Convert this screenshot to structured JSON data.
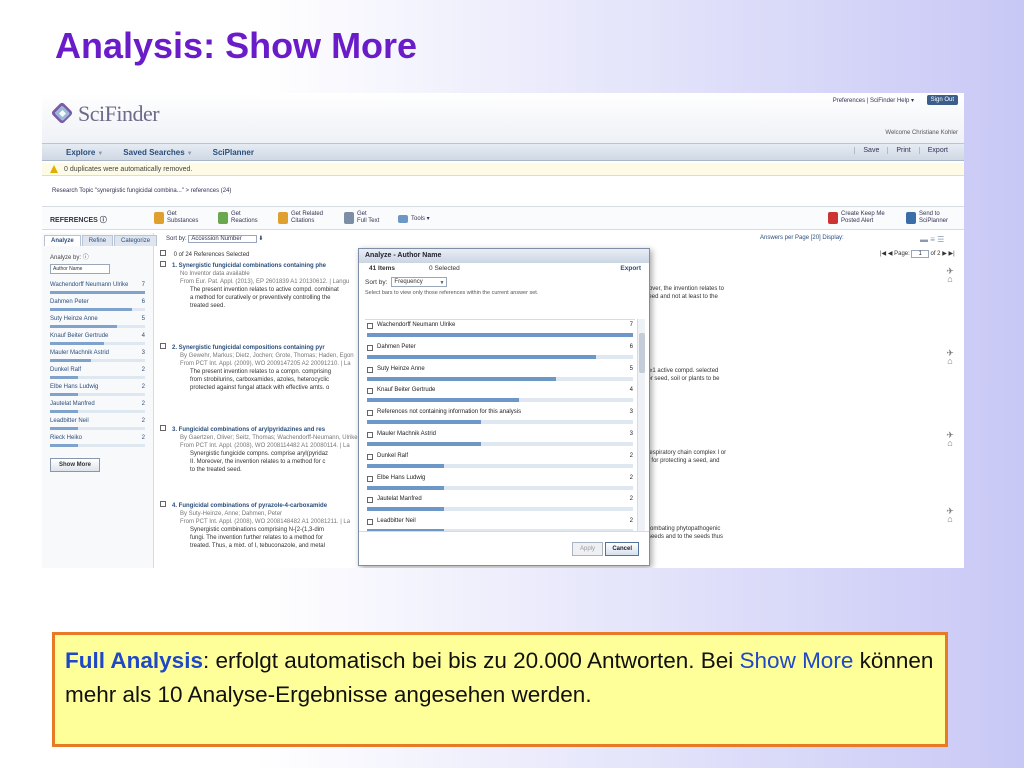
{
  "slide": {
    "title": "Analysis: Show More",
    "note": {
      "part1": "Full Analysis",
      "part2": ": erfolgt automatisch bei bis zu 20.000 Antworten. Bei ",
      "part3": "Show More",
      "part4": " können mehr als 10 Analyse-Ergebnisse angesehen werden."
    }
  },
  "app": {
    "logo": "SciFinder",
    "toplinks": "Preferences | SciFinder Help ▾",
    "signout": "Sign Out",
    "welcome": "Welcome Christiane Kohler",
    "nav": [
      "Explore",
      "Saved Searches",
      "SciPlanner"
    ],
    "nav_right": [
      "Save",
      "Print",
      "Export"
    ],
    "warning": "0 duplicates were automatically removed.",
    "breadcrumb": "Research Topic \"synergistic fungicidal combina...\" > references (24)",
    "references_label": "REFERENCES",
    "tools": [
      {
        "line1": "Get",
        "line2": "Substances",
        "color": "#e0a030"
      },
      {
        "line1": "Get",
        "line2": "Reactions",
        "color": "#6aa84f"
      },
      {
        "line1": "Get Related",
        "line2": "Citations",
        "color": "#e0a030"
      },
      {
        "line1": "Get",
        "line2": "Full Text",
        "color": "#7c8da6"
      },
      {
        "line1": "Tools ▾",
        "line2": "",
        "color": "#6d97c7"
      },
      {
        "line1": "Create Keep Me",
        "line2": "Posted Alert",
        "color": "#cc3333"
      },
      {
        "line1": "Send to",
        "line2": "SciPlanner",
        "color": "#3b6ea8"
      }
    ],
    "left": {
      "tabs": [
        "Analyze",
        "Refine",
        "Categorize"
      ],
      "analyze_by": "Analyze by:",
      "select": "Author Name",
      "authors": [
        {
          "name": "Wachendorff Neumann Ulrike",
          "count": "7",
          "pct": 100
        },
        {
          "name": "Dahmen Peter",
          "count": "6",
          "pct": 86
        },
        {
          "name": "Suty Heinze Anne",
          "count": "5",
          "pct": 71
        },
        {
          "name": "Knauf Beiter Gertrude",
          "count": "4",
          "pct": 57
        },
        {
          "name": "Mauler Machnik Astrid",
          "count": "3",
          "pct": 43
        },
        {
          "name": "Dunkel Ralf",
          "count": "2",
          "pct": 29
        },
        {
          "name": "Elbe Hans Ludwig",
          "count": "2",
          "pct": 29
        },
        {
          "name": "Jautelat Manfred",
          "count": "2",
          "pct": 29
        },
        {
          "name": "Leadbitter Neil",
          "count": "2",
          "pct": 29
        },
        {
          "name": "Rieck Heiko",
          "count": "2",
          "pct": 29
        }
      ],
      "show_more": "Show More"
    },
    "results": {
      "sort_label": "Sort by:",
      "sort_value": "Accession Number",
      "selected": "0 of 24 References Selected",
      "answers": "Answers per Page [20]  Display:",
      "page_label": "Page:",
      "page_value": "1",
      "page_of": "of 2",
      "items": [
        {
          "title": "1. Synergistic fungicidal combinations containing phe",
          "src1": "No Inventor data available",
          "src2": "From Eur. Pat. Appl. (2013), EP 2601839 A1 20130612. | Langu",
          "abs": "The present invention relates to active compd. combinat",
          "abs2": "a method for curatively or preventively controlling the",
          "abs3": "treated seed.",
          "right1": "deriv. and (B) Zoxamide and optionally (C) Cymoxanil.  Moreover, the invention relates to",
          "right2": "and for the treatment of seed, to a method for protecting a seed and not at least to the"
        },
        {
          "title": "2. Synergistic fungicidal compositions containing pyr",
          "src1": "By Gewehr, Markus; Dietz, Jochen; Grote, Thomas; Haden, Egon",
          "src2": "From PCT Int. Appl. (2009), WO 2009147205 A2 20091210. | La",
          "abs": "The present invention relates to a compn. comprising",
          "abs2": "from strobilurins, carboxamides, azoles, heterocyclic",
          "abs3": "protected against fungal attack with effective amts. o",
          "right1": "yl, or alkynyl; R³ = (un)substituted aryl: and X = O or S) and ≥1 active compd. selected",
          "right2": "pathogenic fungi comprises treating the fungi, their habitat, or seed, soil or plants to be"
        },
        {
          "title": "3. Fungicidal combinations of arylpyridazines and res",
          "src1": "By Gaertzen, Oliver; Seitz, Thomas; Wachendorff-Neumann, Ulrike",
          "src2": "From PCT Int. Appl. (2008), WO 2008114482 A1 20080114. | La",
          "abs": "Synergistic fungicide compns. comprise aryl(pyridaz",
          "abs2": "II. Moreover, the invention relates to a method for c",
          "abs3": "to the treated seed.",
          "right1": "1 further fungicidally active compd. acting as an inhibitor of respiratory chain complex I or",
          "right2": "inventive combination for the treatment of seed, to a method for protecting a seed, and"
        },
        {
          "title": "4. Fungicidal combinations of pyrazole-4-carboxamide",
          "src1": "By Suty-Heinze, Anne; Dahmen, Peter",
          "src2": "From PCT Int. Appl. (2008), WO 2008148482 A1 20081211. | La",
          "abs": "Synergistic combinations comprising N-[2-(1,3-dim",
          "abs2": "fungi. The invention further relates to a method for",
          "abs3": "treated. Thus, a mixt. of I, tebuconazole, and metal",
          "right1": "alanine (e.g., metalaxyl), and ≥1 triazole are well-suited for combating phytopathogenic",
          "right2": "es simultaneously or successively, and esp. to treatment of seeds and to the seeds thus"
        }
      ]
    },
    "dialog": {
      "title": "Analyze - Author Name",
      "items_count": "41 Items",
      "selected": "0 Selected",
      "export": "Export",
      "sort_label": "Sort by:",
      "sort_value": "Frequency",
      "hint": "Select bars to view only those references within the current answer set.",
      "rows": [
        {
          "name": "Wachendorff Neumann Ulrike",
          "count": "7",
          "pct": 100
        },
        {
          "name": "Dahmen Peter",
          "count": "6",
          "pct": 86
        },
        {
          "name": "Suty Heinze Anne",
          "count": "5",
          "pct": 71
        },
        {
          "name": "Knauf Beiter Gertrude",
          "count": "4",
          "pct": 57
        },
        {
          "name": "References not containing information for this analysis",
          "count": "3",
          "pct": 43
        },
        {
          "name": "Mauler Machnik Astrid",
          "count": "3",
          "pct": 43
        },
        {
          "name": "Dunkel Ralf",
          "count": "2",
          "pct": 29
        },
        {
          "name": "Elbe Hans Ludwig",
          "count": "2",
          "pct": 29
        },
        {
          "name": "Jautelat Manfred",
          "count": "2",
          "pct": 29
        },
        {
          "name": "Leadbitter Neil",
          "count": "2",
          "pct": 29
        }
      ],
      "apply": "Apply",
      "cancel": "Cancel"
    }
  }
}
